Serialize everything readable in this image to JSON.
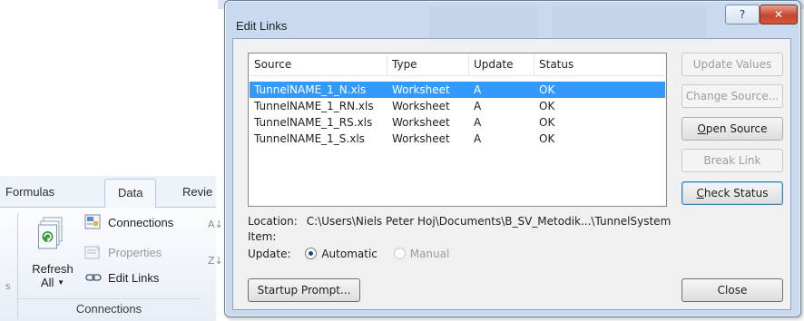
{
  "ribbon": {
    "tabs": [
      "Formulas",
      "Data",
      "Revie"
    ],
    "left_fragment": "s",
    "refresh_label_line1": "Refresh",
    "refresh_label_line2": "All",
    "items": [
      {
        "label": "Connections",
        "icon": "connections-icon",
        "enabled": true
      },
      {
        "label": "Properties",
        "icon": "properties-icon",
        "enabled": false
      },
      {
        "label": "Edit Links",
        "icon": "chain-link-icon",
        "enabled": true
      }
    ],
    "group_label": "Connections",
    "partial_right_labels": [
      "A↓",
      "Z↓"
    ]
  },
  "dialog": {
    "title": "Edit Links",
    "help_glyph": "?",
    "close_glyph": "✕",
    "columns": [
      "Source",
      "Type",
      "Update",
      "Status"
    ],
    "rows": [
      {
        "source": "TunnelNAME_1_N.xls",
        "type": "Worksheet",
        "update": "A",
        "status": "OK",
        "selected": true
      },
      {
        "source": "TunnelNAME_1_RN.xls",
        "type": "Worksheet",
        "update": "A",
        "status": "OK",
        "selected": false
      },
      {
        "source": "TunnelNAME_1_RS.xls",
        "type": "Worksheet",
        "update": "A",
        "status": "OK",
        "selected": false
      },
      {
        "source": "TunnelNAME_1_S.xls",
        "type": "Worksheet",
        "update": "A",
        "status": "OK",
        "selected": false
      }
    ],
    "buttons": {
      "update_values": "Update Values",
      "change_source": "Change Source...",
      "open_source": "Open Source",
      "break_link": "Break Link",
      "check_status": "Check Status",
      "startup_prompt": "Startup Prompt...",
      "close": "Close"
    },
    "location_label": "Location:",
    "location_value": "C:\\Users\\Niels Peter Hoj\\Documents\\B_SV_Metodik...\\TunnelSystem",
    "item_label": "Item:",
    "update_label": "Update:",
    "update_options": {
      "automatic": "Automatic",
      "manual": "Manual"
    },
    "update_selected": "Automatic"
  },
  "colors": {
    "selection": "#3399ff",
    "dialog_frame": "#c9daf0",
    "close_button": "#c6452b"
  }
}
